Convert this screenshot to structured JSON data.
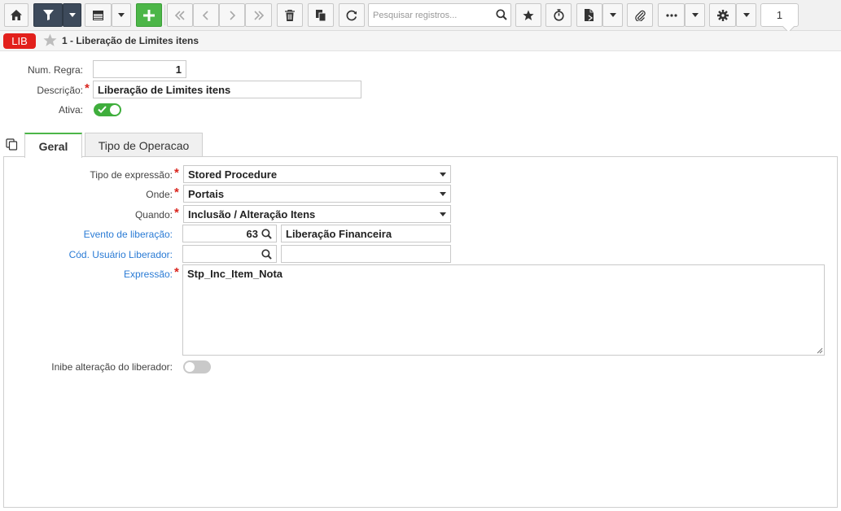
{
  "toolbar": {
    "search_placeholder": "Pesquisar registros...",
    "page_number": "1",
    "colors": {
      "dark_button": "#3d4a5b",
      "add_button": "#4cb648"
    }
  },
  "header": {
    "badge": "LIB",
    "title": "1 - Liberação de Limites itens"
  },
  "form": {
    "num_regra": {
      "label": "Num. Regra:",
      "value": "1"
    },
    "descricao": {
      "label": "Descrição:",
      "value": "Liberação de Limites itens"
    },
    "ativa": {
      "label": "Ativa:",
      "checked": true
    }
  },
  "tabs": [
    {
      "label": "Geral",
      "active": true
    },
    {
      "label": "Tipo de Operacao",
      "active": false
    }
  ],
  "geral": {
    "tipo_expressao": {
      "label": "Tipo de expressão:",
      "value": "Stored Procedure"
    },
    "onde": {
      "label": "Onde:",
      "value": "Portais"
    },
    "quando": {
      "label": "Quando:",
      "value": "Inclusão / Alteração Itens"
    },
    "evento": {
      "label": "Evento de liberação:",
      "code": "63",
      "description": "Liberação Financeira"
    },
    "usuario": {
      "label": "Cód. Usuário Liberador:",
      "code": "",
      "description": ""
    },
    "expressao": {
      "label": "Expressão:",
      "value": "Stp_Inc_Item_Nota"
    },
    "inibe": {
      "label": "Inibe alteração do liberador:",
      "checked": false
    }
  },
  "colors": {
    "required": "#d9241d",
    "link_label": "#2a7bd5",
    "toggle_on": "#3fae3c",
    "toggle_off": "#c9c9c9",
    "badge": "#e2201c"
  }
}
